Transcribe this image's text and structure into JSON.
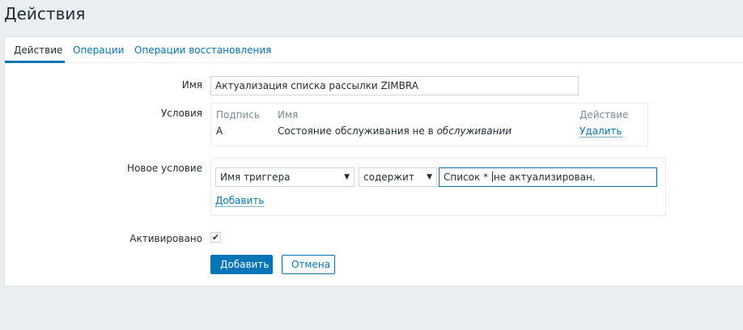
{
  "page": {
    "title": "Действия"
  },
  "tabs": [
    {
      "label": "Действие"
    },
    {
      "label": "Операции"
    },
    {
      "label": "Операции восстановления"
    }
  ],
  "form": {
    "name_label": "Имя",
    "name_value": "Актуализация списка рассылки ZIMBRA",
    "conditions_label": "Условия",
    "conditions_table": {
      "headers": {
        "label": "Подпись",
        "name": "Имя",
        "action": "Действие"
      },
      "rows": [
        {
          "label": "A",
          "name_prefix": "Состояние обслуживания не в ",
          "name_italic": "обслуживании",
          "action": "Удалить"
        }
      ]
    },
    "new_condition_label": "Новое условие",
    "new_condition": {
      "type_select": "Имя триггера",
      "operator_select": "содержит",
      "value_before_caret": "Список * ",
      "value_after_caret": "не актуализирован.",
      "add_link": "Добавить"
    },
    "enabled_label": "Активировано",
    "enabled_checked": true
  },
  "buttons": {
    "add": "Добавить",
    "cancel": "Отмена"
  },
  "icons": {
    "dropdown": "▼",
    "check": "✔"
  }
}
